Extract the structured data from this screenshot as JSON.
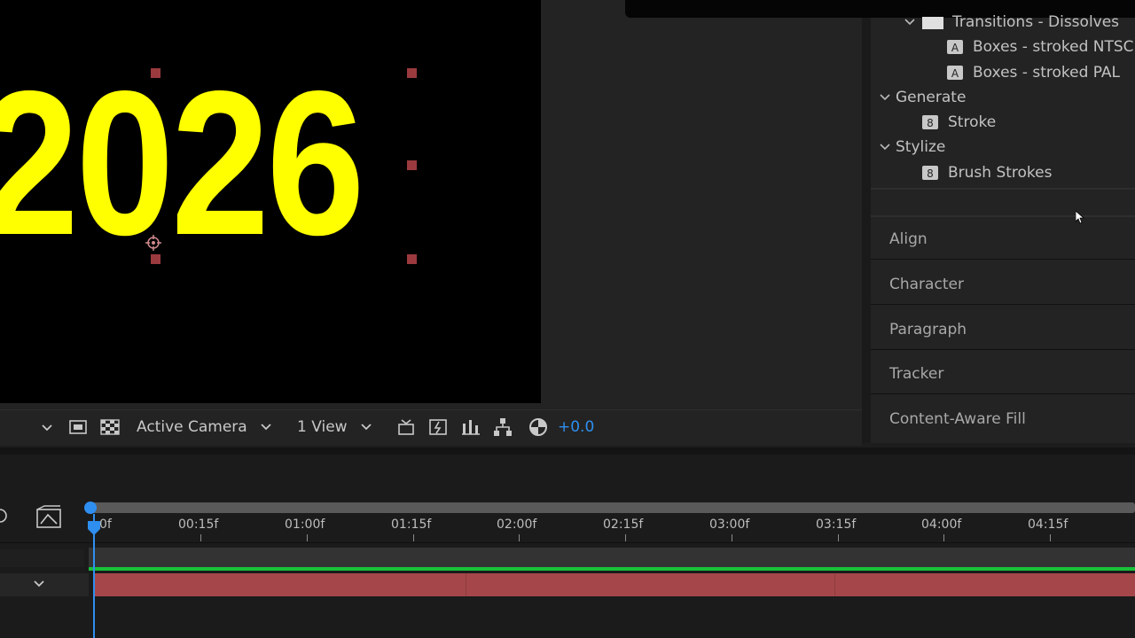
{
  "composition": {
    "text": "2026",
    "text_color": "#ffff00"
  },
  "viewer_toolbar": {
    "camera": "Active Camera",
    "views": "1 View",
    "exposure": "+0.0",
    "exposure_color": "#2f8ff0"
  },
  "effects_tree": {
    "items": [
      {
        "label": "Transitions - Dissolves",
        "kind": "folder"
      },
      {
        "label": "Boxes - stroked NTSC",
        "kind": "preset"
      },
      {
        "label": "Boxes - stroked PAL",
        "kind": "preset"
      },
      {
        "label": "Generate",
        "kind": "category"
      },
      {
        "label": "Stroke",
        "kind": "effect"
      },
      {
        "label": "Stylize",
        "kind": "category"
      },
      {
        "label": "Brush Strokes",
        "kind": "effect"
      }
    ]
  },
  "panels": [
    "Align",
    "Character",
    "Paragraph",
    "Tracker",
    "Content-Aware Fill"
  ],
  "timeline": {
    "start_label": "0f",
    "ticks": [
      "00:15f",
      "01:00f",
      "01:15f",
      "02:00f",
      "02:15f",
      "03:00f",
      "03:15f",
      "04:00f",
      "04:15f"
    ],
    "playhead_color": "#2f8ff0",
    "track_color": "#a5474a",
    "work_area_color": "#18c23a"
  }
}
